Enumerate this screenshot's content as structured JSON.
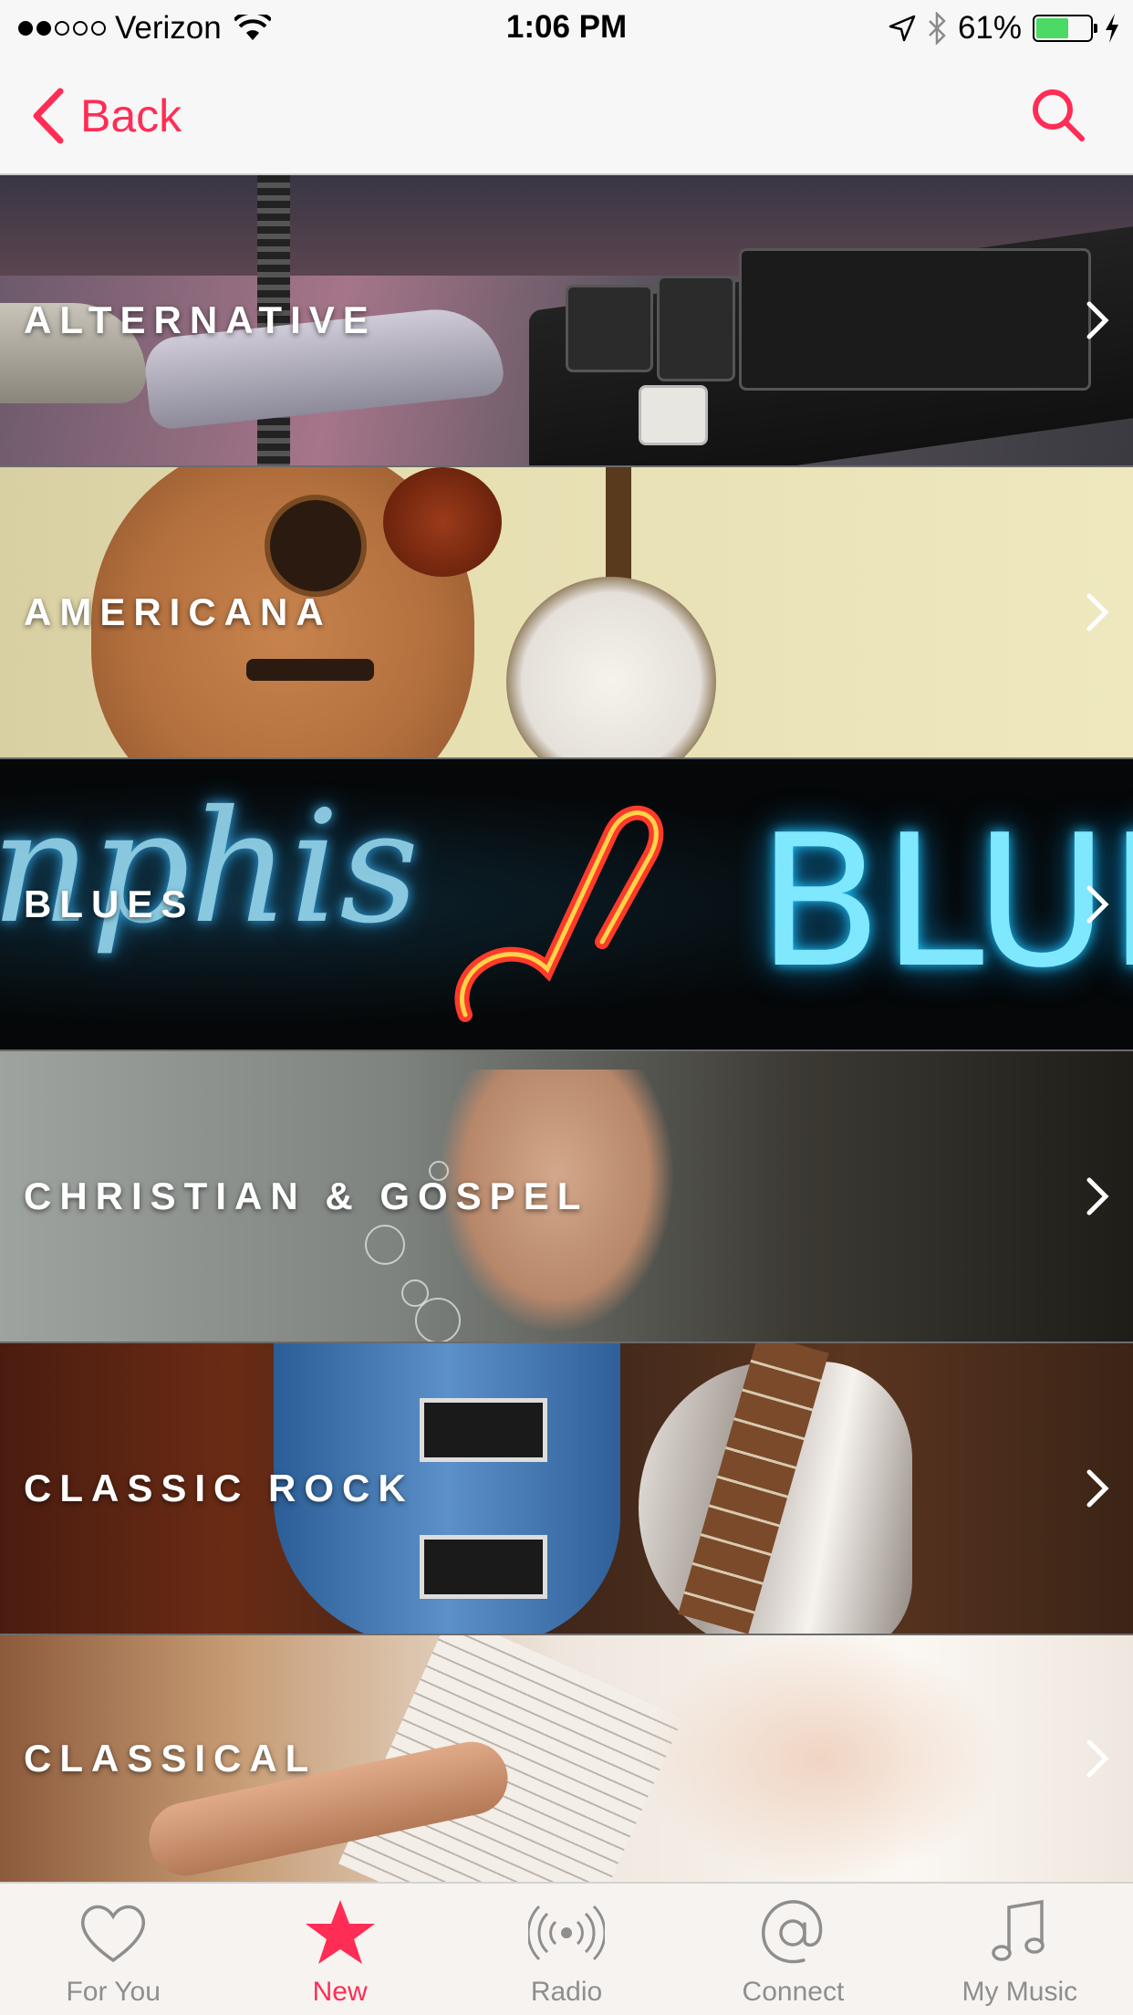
{
  "status_bar": {
    "signal_dots": [
      true,
      true,
      false,
      false,
      false
    ],
    "carrier": "Verizon",
    "time": "1:06 PM",
    "battery": "61%",
    "battery_level": 0.61
  },
  "nav": {
    "back_label": "Back"
  },
  "genres": [
    {
      "label": "ALTERNATIVE"
    },
    {
      "label": "AMERICANA"
    },
    {
      "label": "BLUES"
    },
    {
      "label": "CHRISTIAN & GOSPEL"
    },
    {
      "label": "CLASSIC ROCK"
    },
    {
      "label": "CLASSICAL"
    }
  ],
  "blues_sign": {
    "left_text": "nphis",
    "right_text": "BLUE"
  },
  "tabs": [
    {
      "label": "For You",
      "icon": "heart-icon"
    },
    {
      "label": "New",
      "icon": "star-icon",
      "active": true
    },
    {
      "label": "Radio",
      "icon": "radio-icon"
    },
    {
      "label": "Connect",
      "icon": "at-icon"
    },
    {
      "label": "My Music",
      "icon": "music-note-icon"
    }
  ],
  "colors": {
    "accent": "#ff2d55",
    "inactive": "#8e8e8e",
    "battery_green": "#4cd964"
  }
}
